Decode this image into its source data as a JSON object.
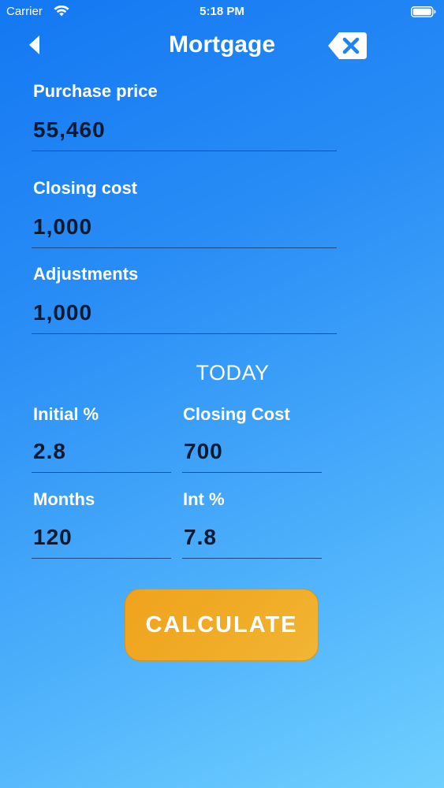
{
  "status_bar": {
    "carrier": "Carrier",
    "time": "5:18 PM",
    "wifi_icon": "wifi-icon",
    "battery_icon": "battery-icon"
  },
  "nav": {
    "title": "Mortgage",
    "back_icon": "chevron-left-icon",
    "clear_icon": "backspace-icon"
  },
  "fields": {
    "purchase_price": {
      "label": "Purchase price",
      "value": "55,460"
    },
    "closing_cost": {
      "label": "Closing cost",
      "value": "1,000"
    },
    "adjustments": {
      "label": "Adjustments",
      "value": "1,000"
    }
  },
  "today": {
    "title": "TODAY",
    "initial_pct": {
      "label": "Initial %",
      "value": "2.8"
    },
    "closing_cost": {
      "label": "Closing Cost",
      "value": "700"
    },
    "months": {
      "label": "Months",
      "value": "120"
    },
    "int_pct": {
      "label": "Int %",
      "value": "7.8"
    }
  },
  "actions": {
    "calculate_label": "CALCULATE"
  },
  "colors": {
    "background_start": "#1378f2",
    "background_end": "#6fd0fe",
    "button": "#f0a21d",
    "value_text": "#0d1a2e",
    "underline": "#1d4a86"
  }
}
